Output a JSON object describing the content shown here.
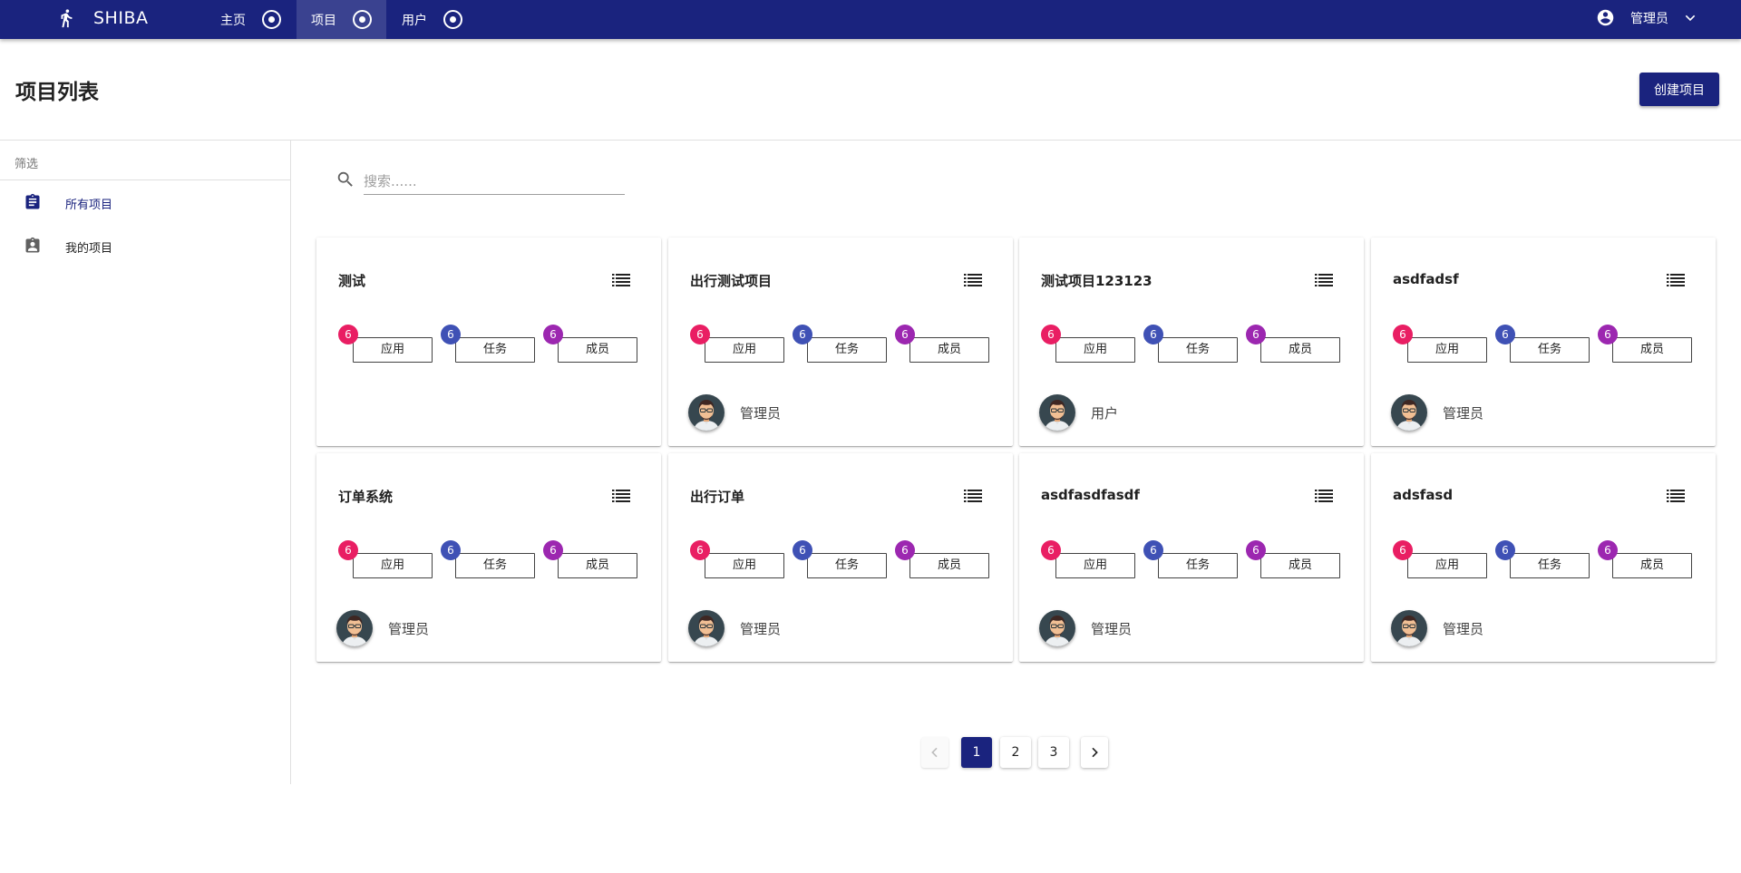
{
  "app": {
    "brand": "SHIBA",
    "brand_icon": "runner-icon"
  },
  "nav": {
    "tabs": [
      {
        "label": "主页",
        "active": false
      },
      {
        "label": "项目",
        "active": true
      },
      {
        "label": "用户",
        "active": false
      }
    ],
    "user": {
      "name": "管理员"
    }
  },
  "header": {
    "title": "项目列表",
    "create_label": "创建项目"
  },
  "sidebar": {
    "title": "筛选",
    "items": [
      {
        "label": "所有项目",
        "active": true,
        "icon": "clipboard-icon"
      },
      {
        "label": "我的项目",
        "active": false,
        "icon": "assignment-ind-icon"
      }
    ]
  },
  "search": {
    "placeholder": "搜索......",
    "value": ""
  },
  "projects": [
    {
      "name": "测试",
      "apps": "6",
      "tasks": "6",
      "members": "6",
      "owner": ""
    },
    {
      "name": "出行测试项目",
      "apps": "6",
      "tasks": "6",
      "members": "6",
      "owner": "管理员"
    },
    {
      "name": "测试项目123123",
      "apps": "6",
      "tasks": "6",
      "members": "6",
      "owner": "用户"
    },
    {
      "name": "asdfadsf",
      "apps": "6",
      "tasks": "6",
      "members": "6",
      "owner": "管理员"
    },
    {
      "name": "订单系统",
      "apps": "6",
      "tasks": "6",
      "members": "6",
      "owner": "管理员"
    },
    {
      "name": "出行订单",
      "apps": "6",
      "tasks": "6",
      "members": "6",
      "owner": "管理员"
    },
    {
      "name": "asdfasdfasdf",
      "apps": "6",
      "tasks": "6",
      "members": "6",
      "owner": "管理员"
    },
    {
      "name": "adsfasd",
      "apps": "6",
      "tasks": "6",
      "members": "6",
      "owner": "管理员"
    }
  ],
  "card_labels": {
    "apps": "应用",
    "tasks": "任务",
    "members": "成员"
  },
  "pagination": {
    "pages": [
      "1",
      "2",
      "3"
    ],
    "current": "1"
  },
  "colors": {
    "primary": "#1a237e",
    "badge_apps": "#e91e63",
    "badge_tasks": "#3f51b5",
    "badge_members": "#9c27b0"
  }
}
